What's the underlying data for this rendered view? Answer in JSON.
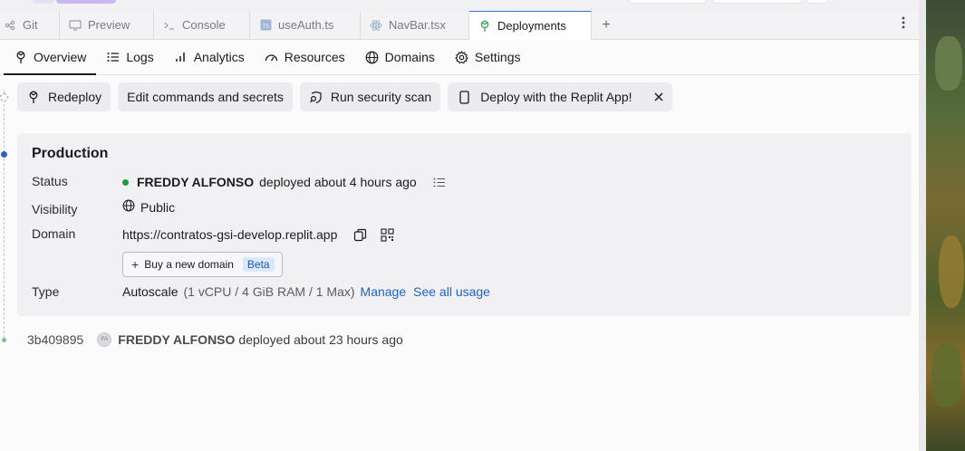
{
  "tabs": [
    {
      "label": "Git",
      "icon": "git-icon"
    },
    {
      "label": "Preview",
      "icon": "monitor-icon"
    },
    {
      "label": "Console",
      "icon": "terminal-icon"
    },
    {
      "label": "useAuth.ts",
      "icon": "typescript-file-icon"
    },
    {
      "label": "NavBar.tsx",
      "icon": "react-file-icon"
    },
    {
      "label": "Deployments",
      "icon": "deployments-icon",
      "active": true
    }
  ],
  "subnav": [
    {
      "label": "Overview",
      "icon": "deployments-icon",
      "active": true
    },
    {
      "label": "Logs",
      "icon": "list-icon"
    },
    {
      "label": "Analytics",
      "icon": "bar-chart-icon"
    },
    {
      "label": "Resources",
      "icon": "gauge-icon"
    },
    {
      "label": "Domains",
      "icon": "globe-icon"
    },
    {
      "label": "Settings",
      "icon": "gear-icon"
    }
  ],
  "actions": {
    "redeploy": "Redeploy",
    "edit_commands": "Edit commands and secrets",
    "security_scan": "Run security scan",
    "deploy_app": "Deploy with the Replit App!"
  },
  "production": {
    "title": "Production",
    "status_label": "Status",
    "status_user": "FREDDY ALFONSO",
    "status_text": "deployed about 4 hours ago",
    "visibility_label": "Visibility",
    "visibility_value": "Public",
    "domain_label": "Domain",
    "domain_value": "https://contratos-gsi-develop.replit.app",
    "buy_domain": "Buy a new domain",
    "beta": "Beta",
    "type_label": "Type",
    "type_value": "Autoscale",
    "type_spec": "(1 vCPU / 4 GiB RAM / 1 Max)",
    "manage": "Manage",
    "see_usage": "See all usage"
  },
  "previous": {
    "hash": "3b409895",
    "avatar_initials": "FA",
    "user": "FREDDY ALFONSO",
    "text": "deployed about 23 hours ago"
  },
  "colors": {
    "accent": "#2261c7",
    "status_green": "#1f9d3a",
    "beta_bg": "#dbe8fb"
  }
}
